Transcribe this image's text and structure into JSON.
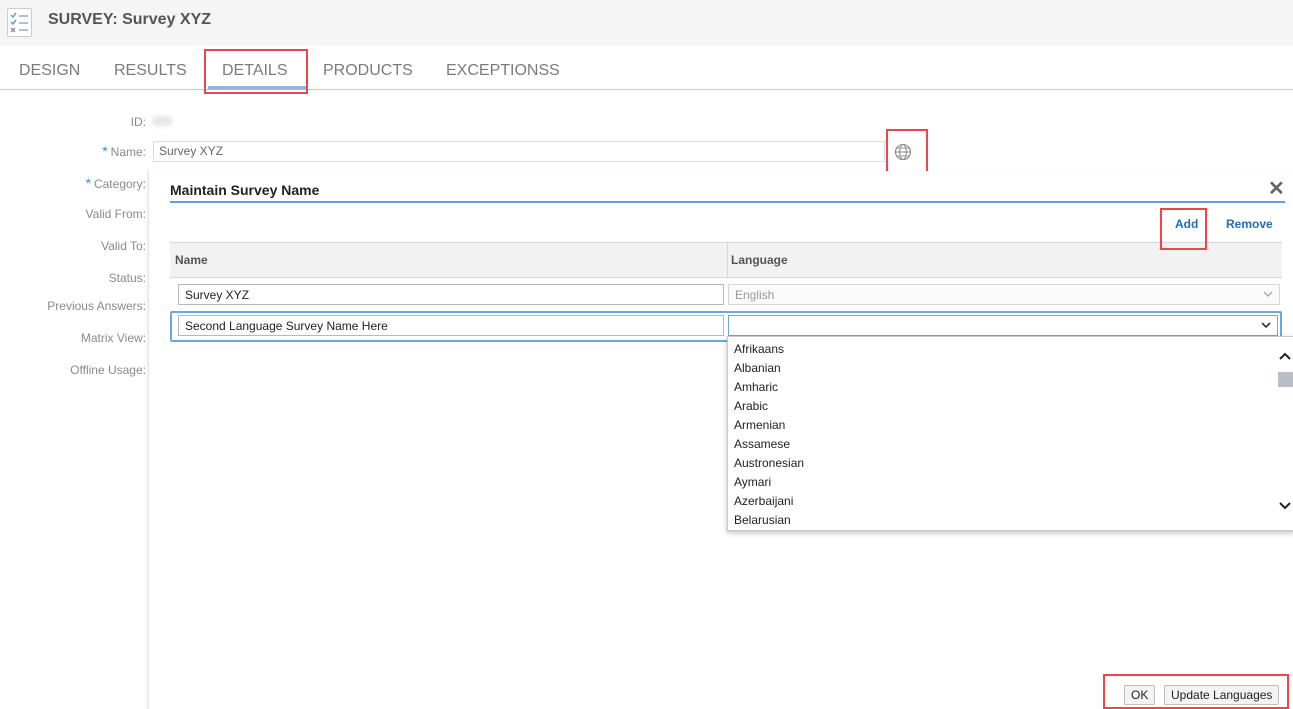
{
  "header": {
    "title": "SURVEY: Survey XYZ",
    "app_icon": "survey-checklist-icon"
  },
  "tabs": [
    {
      "label": "DESIGN"
    },
    {
      "label": "RESULTS"
    },
    {
      "label": "DETAILS",
      "active": true
    },
    {
      "label": "PRODUCTS"
    },
    {
      "label": "EXCEPTIONSS"
    }
  ],
  "form": {
    "id_label": "ID:",
    "name_label": "Name:",
    "name_value": "Survey XYZ",
    "category_label": "Category:",
    "valid_from_label": "Valid From:",
    "valid_to_label": "Valid To:",
    "status_label": "Status:",
    "previous_answers_label": "Previous Answers:",
    "matrix_view_label": "Matrix View:",
    "offline_usage_label": "Offline Usage:",
    "required_marker": "*",
    "translate_icon": "globe-icon"
  },
  "dialog": {
    "title": "Maintain Survey Name",
    "close_icon": "close-icon",
    "add_label": "Add",
    "remove_label": "Remove",
    "columns": {
      "name": "Name",
      "language": "Language"
    },
    "rows": [
      {
        "name": "Survey XYZ",
        "language": "English"
      },
      {
        "name": "Second Language Survey Name Here",
        "language": ""
      }
    ],
    "language_options": [
      "Afrikaans",
      "Albanian",
      "Amharic",
      "Arabic",
      "Armenian",
      "Assamese",
      "Austronesian",
      "Aymari",
      "Azerbaijani",
      "Belarusian"
    ],
    "ok_label": "OK",
    "update_label": "Update Languages"
  },
  "colors": {
    "highlight": "#e8474c",
    "accent": "#1c6fb8",
    "tab_underline": "#8db8e0"
  }
}
